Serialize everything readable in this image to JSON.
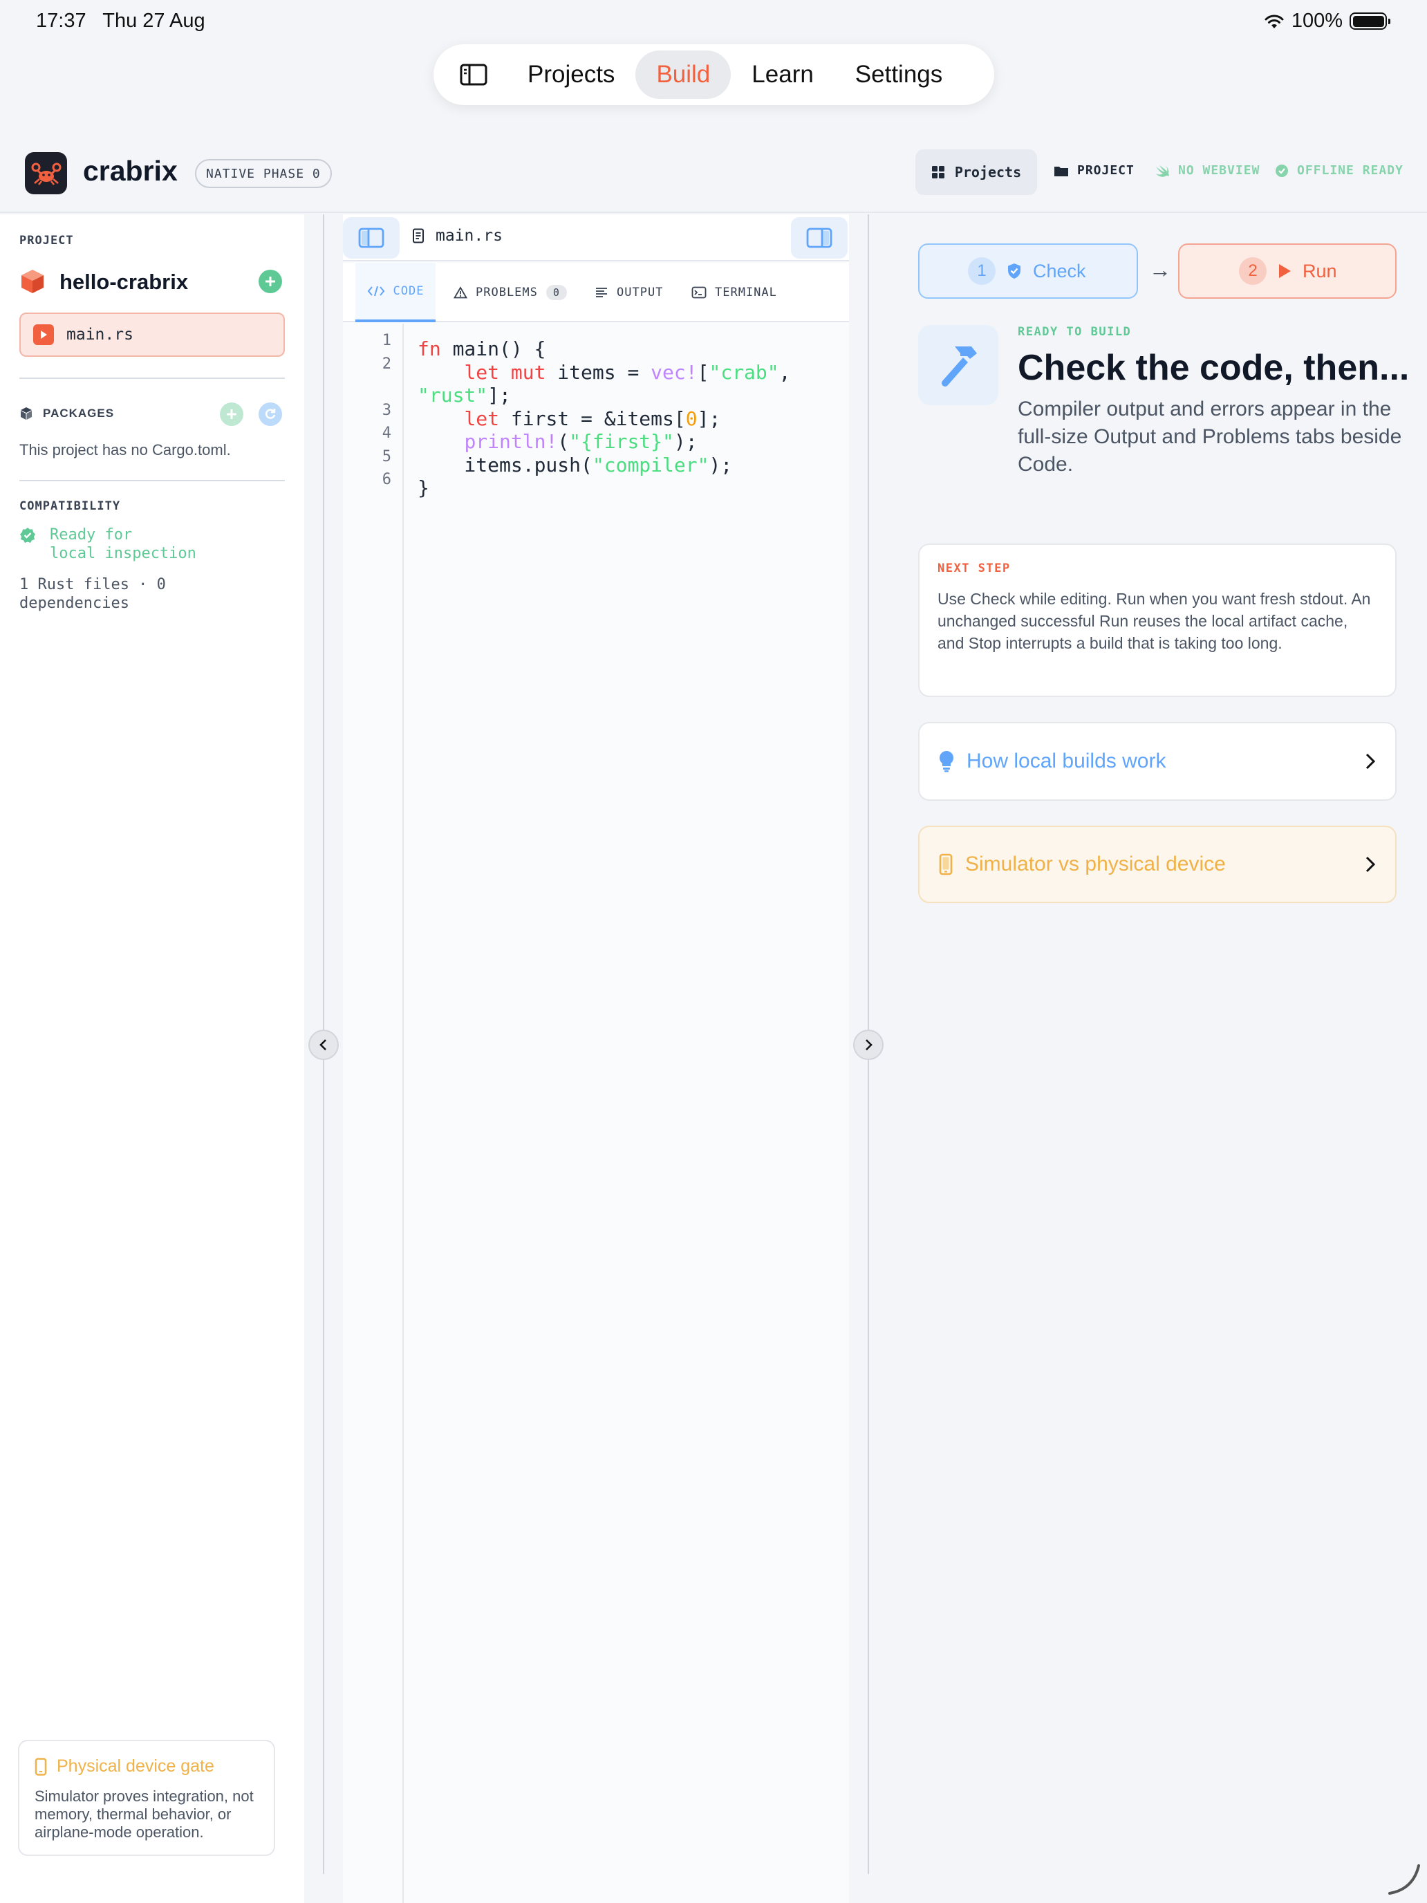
{
  "status_bar": {
    "time": "17:37",
    "date": "Thu 27 Aug",
    "battery": "100%"
  },
  "top_nav": {
    "tabs": [
      {
        "label": "Projects"
      },
      {
        "label": "Build"
      },
      {
        "label": "Learn"
      },
      {
        "label": "Settings"
      }
    ],
    "active": "Build"
  },
  "header": {
    "app_name": "crabrix",
    "phase_badge": "NATIVE PHASE 0",
    "projects_button": "Projects",
    "project_label": "PROJECT",
    "webview_label": "NO WEBVIEW",
    "offline_label": "OFFLINE READY"
  },
  "sidebar": {
    "project_title": "PROJECT",
    "project_name": "hello-crabrix",
    "file": "main.rs",
    "packages_title": "PACKAGES",
    "packages_text": "This project has no Cargo.toml.",
    "compat_title": "COMPATIBILITY",
    "compat_ready_line1": "Ready for",
    "compat_ready_line2": "local inspection",
    "compat_files_line1": "1 Rust files · 0",
    "compat_files_line2": "dependencies",
    "gate_title": "Physical device gate",
    "gate_text": "Simulator proves integration, not memory, thermal behavior, or airplane-mode operation."
  },
  "editor": {
    "file_name": "main.rs",
    "tabs": [
      {
        "label": "CODE"
      },
      {
        "label": "PROBLEMS",
        "count": "0"
      },
      {
        "label": "OUTPUT"
      },
      {
        "label": "TERMINAL"
      }
    ],
    "line_numbers": [
      "1",
      "2",
      "3",
      "4",
      "5",
      "6"
    ]
  },
  "right_panel": {
    "check_step": "1",
    "check_label": "Check",
    "run_step": "2",
    "run_label": "Run",
    "ready_label": "READY TO BUILD",
    "title": "Check the code, then...",
    "description": "Compiler output and errors appear in the full-size Output and Problems tabs beside Code.",
    "next_step_label": "NEXT STEP",
    "next_step_text": "Use Check while editing. Run when you want fresh stdout. An unchanged successful Run reuses the local artifact cache, and Stop interrupts a build that is taking too long.",
    "link_builds": "How local builds work",
    "link_device": "Simulator vs physical device"
  },
  "colors": {
    "accent": "#f2613f",
    "blue": "#60a5fa",
    "green": "#5fc996",
    "amber": "#f0b248"
  }
}
